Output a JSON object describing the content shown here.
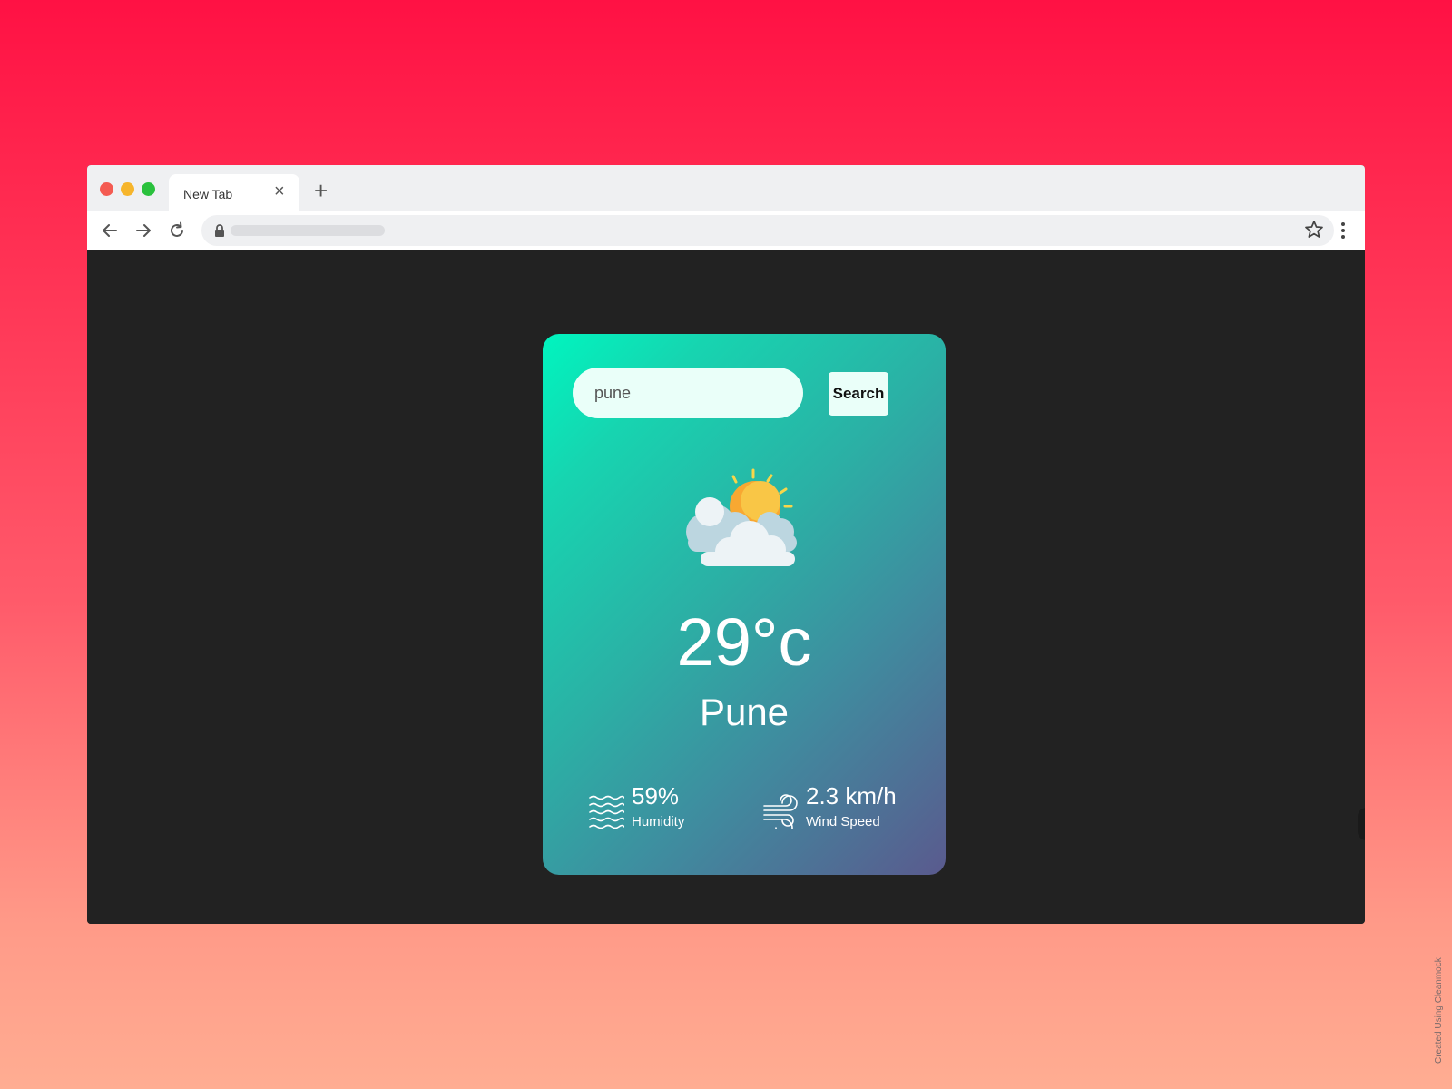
{
  "browser": {
    "tab": {
      "title": "New Tab",
      "close_glyph": "×"
    },
    "new_tab_glyph": "+",
    "window_controls": {
      "colors": [
        "#f45b52",
        "#f6b52c",
        "#2ac13d"
      ]
    },
    "toolbar": {
      "icons": [
        "back-arrow-icon",
        "forward-arrow-icon",
        "reload-icon",
        "lock-icon",
        "bookmark-star-icon",
        "more-menu-icon"
      ]
    }
  },
  "weather": {
    "search": {
      "value": "pune",
      "button_label": "Search"
    },
    "icon": "partly-cloudy-icon",
    "temperature": "29°c",
    "city": "Pune",
    "humidity": {
      "value": "59%",
      "label": "Humidity",
      "icon": "humidity-waves-icon"
    },
    "wind": {
      "value": "2.3 km/h",
      "label": "Wind Speed",
      "icon": "wind-icon"
    },
    "colors": {
      "gradient_start": "#00f5bf",
      "gradient_end": "#5a5a8e"
    }
  },
  "watermark": "Created Using Cleanmock"
}
